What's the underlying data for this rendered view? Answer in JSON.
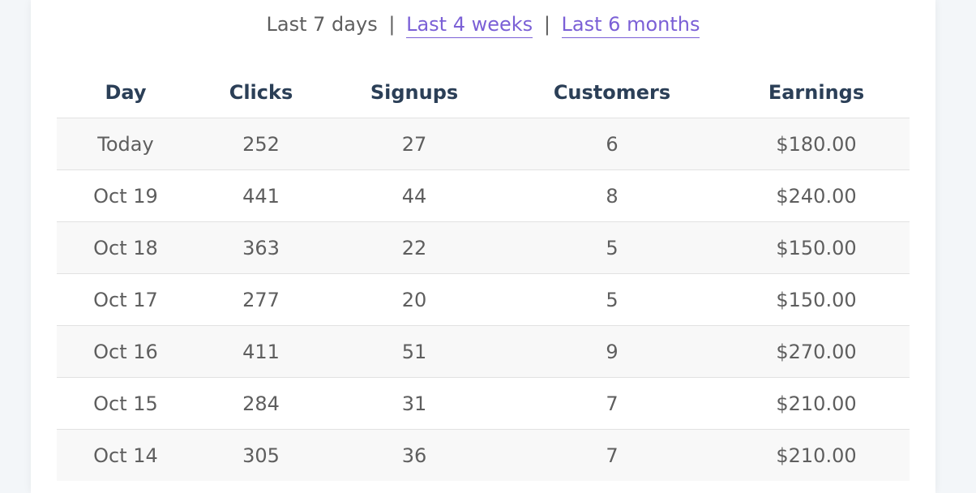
{
  "range_selector": {
    "current": "Last 7 days",
    "separator": "|",
    "links": [
      "Last 4 weeks",
      "Last 6 months"
    ]
  },
  "table": {
    "headers": [
      "Day",
      "Clicks",
      "Signups",
      "Customers",
      "Earnings"
    ],
    "rows": [
      [
        "Today",
        "252",
        "27",
        "6",
        "$180.00"
      ],
      [
        "Oct 19",
        "441",
        "44",
        "8",
        "$240.00"
      ],
      [
        "Oct 18",
        "363",
        "22",
        "5",
        "$150.00"
      ],
      [
        "Oct 17",
        "277",
        "20",
        "5",
        "$150.00"
      ],
      [
        "Oct 16",
        "411",
        "51",
        "9",
        "$270.00"
      ],
      [
        "Oct 15",
        "284",
        "31",
        "7",
        "$210.00"
      ],
      [
        "Oct 14",
        "305",
        "36",
        "7",
        "$210.00"
      ]
    ]
  },
  "colors": {
    "link": "#7b60d6",
    "header_text": "#2b3f57",
    "body_text": "#5e5e5e",
    "striped_row": "#f8f8f8",
    "page_background": "#f3f6f9"
  }
}
